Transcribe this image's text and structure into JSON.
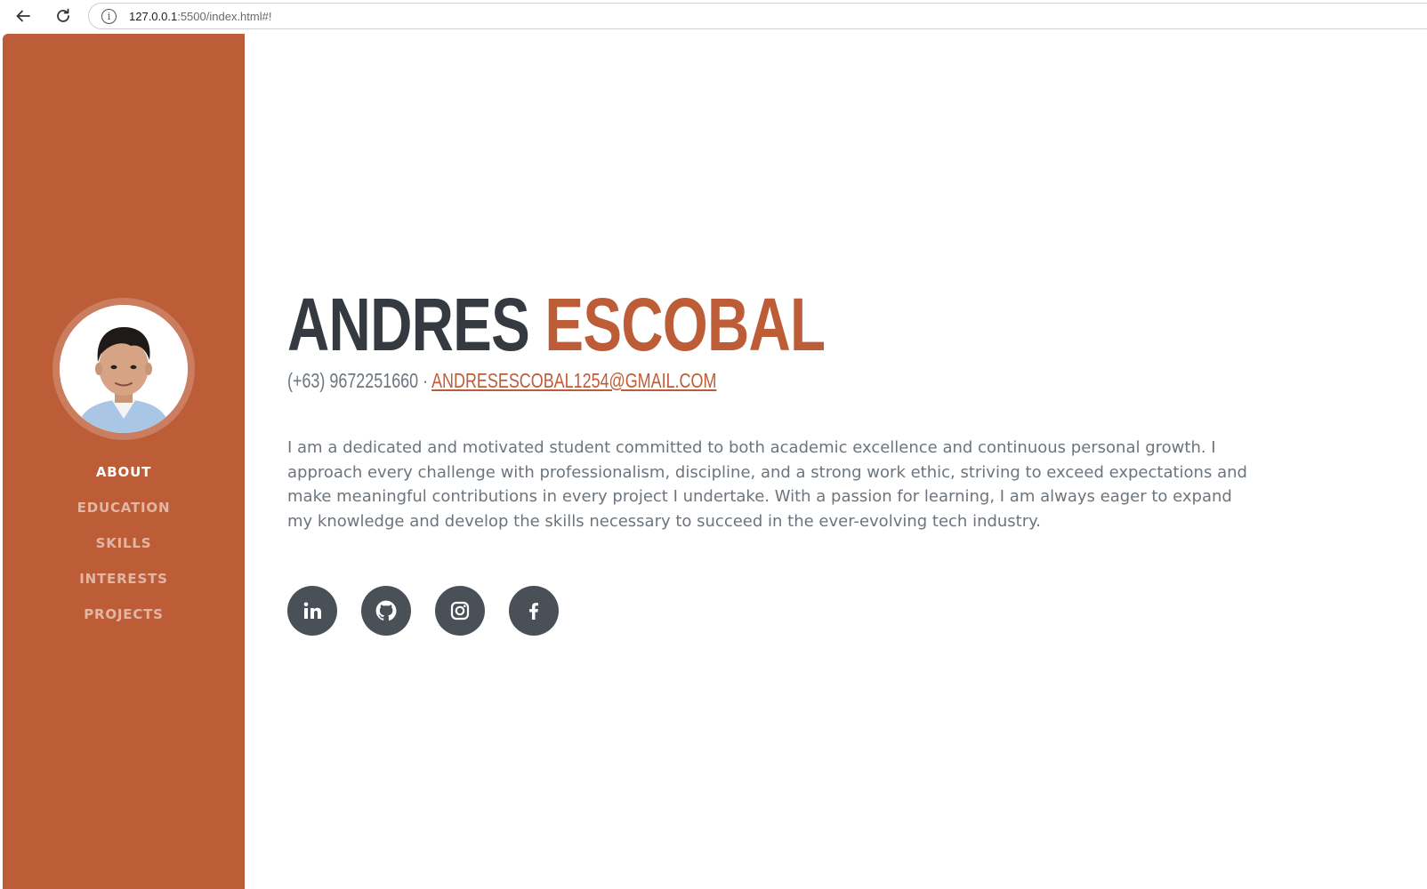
{
  "browser": {
    "url_host": "127.0.0.1",
    "url_path": ":5500/index.html#!"
  },
  "sidebar": {
    "nav": [
      {
        "label": "ABOUT",
        "active": true
      },
      {
        "label": "EDUCATION",
        "active": false
      },
      {
        "label": "SKILLS",
        "active": false
      },
      {
        "label": "INTERESTS",
        "active": false
      },
      {
        "label": "PROJECTS",
        "active": false
      }
    ]
  },
  "about": {
    "first_name": "ANDRES",
    "last_name": "ESCOBAL",
    "phone": "(+63) 9672251660 ·",
    "email": "andresescobal1254@gmail.com",
    "bio": "I am a dedicated and motivated student committed to both academic excellence and continuous personal growth. I approach every challenge with professionalism, discipline, and a strong work ethic, striving to exceed expectations and make meaningful contributions in every project I undertake. With a passion for learning, I am always eager to expand my knowledge and develop the skills necessary to succeed in the ever-evolving tech industry."
  },
  "socials": [
    {
      "icon": "linkedin-icon"
    },
    {
      "icon": "github-icon"
    },
    {
      "icon": "instagram-icon"
    },
    {
      "icon": "facebook-icon"
    }
  ],
  "colors": {
    "primary": "#bd5d38",
    "heading": "#343a40",
    "text": "#6c757d",
    "social_bg": "#495057"
  }
}
